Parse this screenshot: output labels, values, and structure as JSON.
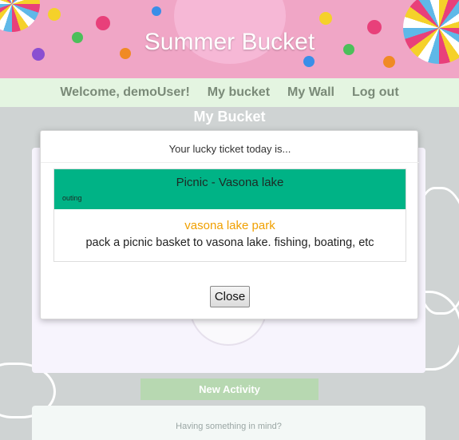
{
  "header": {
    "title": "Summer Bucket"
  },
  "nav": {
    "welcome": "Welcome, demoUser!",
    "my_bucket": "My bucket",
    "my_wall": "My Wall",
    "logout": "Log out"
  },
  "page": {
    "section_title": "My Bucket",
    "new_activity_label": "New Activity",
    "idea_prompt": "Having something in mind?"
  },
  "modal": {
    "heading": "Your lucky ticket today is...",
    "ticket": {
      "title": "Picnic - Vasona lake",
      "category": "outing",
      "location": "vasona lake park",
      "description": "pack a picnic basket to vasona lake. fishing, boating, etc"
    },
    "close_label": "Close"
  },
  "colors": {
    "ticket_header": "#00b386",
    "location_text": "#f0a000",
    "navbar": "#e4f5e1"
  }
}
